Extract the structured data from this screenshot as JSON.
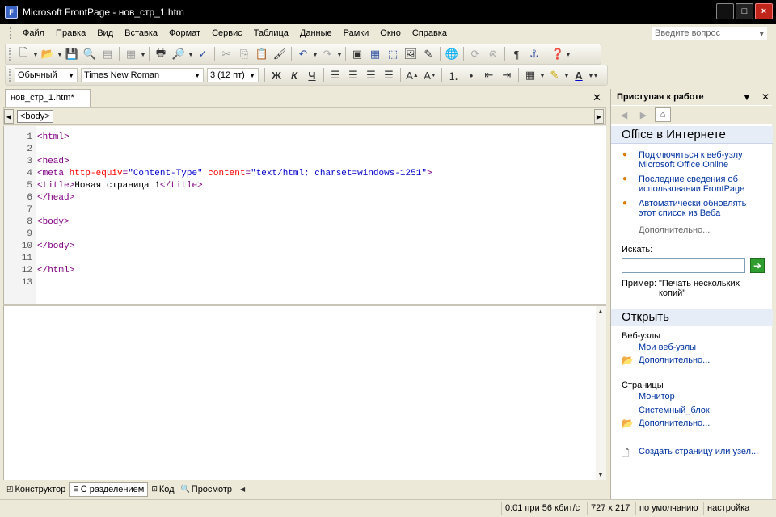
{
  "window": {
    "title": "Microsoft FrontPage - нов_стр_1.htm",
    "icon": "frontpage-app-icon",
    "controls": {
      "minimize": "_",
      "maximize": "□",
      "close": "×"
    }
  },
  "menu": {
    "items": [
      "Файл",
      "Правка",
      "Вид",
      "Вставка",
      "Формат",
      "Сервис",
      "Таблица",
      "Данные",
      "Рамки",
      "Окно",
      "Справка"
    ],
    "ask_placeholder": "Введите вопрос"
  },
  "formatting": {
    "style": "Обычный",
    "font": "Times New Roman",
    "size": "3  (12 пт)",
    "bold": "Ж",
    "italic": "К",
    "underline": "Ч"
  },
  "document": {
    "tab_label": "нов_стр_1.htm*",
    "tag_path": "<body>",
    "code_lines": [
      {
        "n": "1",
        "parts": [
          {
            "c": "t-tag",
            "t": "<html>"
          }
        ]
      },
      {
        "n": "2",
        "parts": []
      },
      {
        "n": "3",
        "parts": [
          {
            "c": "t-tag",
            "t": "<head>"
          }
        ]
      },
      {
        "n": "4",
        "parts": [
          {
            "c": "t-tag",
            "t": "<meta "
          },
          {
            "c": "t-attr",
            "t": "http-equiv"
          },
          {
            "c": "t-tag",
            "t": "="
          },
          {
            "c": "t-val",
            "t": "\"Content-Type\""
          },
          {
            "c": "t-tag",
            "t": " "
          },
          {
            "c": "t-attr",
            "t": "content"
          },
          {
            "c": "t-tag",
            "t": "="
          },
          {
            "c": "t-val",
            "t": "\"text/html; charset=windows-1251\""
          },
          {
            "c": "t-tag",
            "t": ">"
          }
        ]
      },
      {
        "n": "5",
        "parts": [
          {
            "c": "t-tag",
            "t": "<title>"
          },
          {
            "c": "t-txt",
            "t": "Новая страница 1"
          },
          {
            "c": "t-tag",
            "t": "</title>"
          }
        ]
      },
      {
        "n": "6",
        "parts": [
          {
            "c": "t-tag",
            "t": "</head>"
          }
        ]
      },
      {
        "n": "7",
        "parts": []
      },
      {
        "n": "8",
        "parts": [
          {
            "c": "t-tag",
            "t": "<body>"
          }
        ]
      },
      {
        "n": "9",
        "parts": []
      },
      {
        "n": "10",
        "parts": [
          {
            "c": "t-tag",
            "t": "</body>"
          }
        ]
      },
      {
        "n": "11",
        "parts": []
      },
      {
        "n": "12",
        "parts": [
          {
            "c": "t-tag",
            "t": "</html>"
          }
        ]
      },
      {
        "n": "13",
        "parts": []
      }
    ]
  },
  "view_tabs": {
    "design": "Конструктор",
    "split": "С разделением",
    "code": "Код",
    "preview": "Просмотр",
    "active": "split"
  },
  "status": {
    "download": "0:01 при 56 кбит/с",
    "dimensions": "727 x 217",
    "mode": "по умолчанию",
    "settings": "настройка"
  },
  "taskpane": {
    "title": "Приступая к работе",
    "office_section": "Office в Интернете",
    "links": [
      "Подключиться к веб-узлу Microsoft Office Online",
      "Последние сведения об использовании FrontPage",
      "Автоматически обновлять этот список из Веба"
    ],
    "more": "Дополнительно...",
    "search_label": "Искать:",
    "search_value": "",
    "example_label": "Пример:",
    "example_text": "\"Печать нескольких копий\"",
    "open_section": "Открыть",
    "websites_label": "Веб-узлы",
    "my_websites": "Мои веб-узлы",
    "websites_more": "Дополнительно...",
    "pages_label": "Страницы",
    "page_1": "Монитор",
    "page_2": "Системный_блок",
    "pages_more": "Дополнительно...",
    "create": "Создать страницу или узел..."
  },
  "colors": {
    "accent_link": "#0033a0",
    "bullet": "#e07a00",
    "tag": "#800080",
    "attr": "#ff0000",
    "value": "#0000cc"
  }
}
